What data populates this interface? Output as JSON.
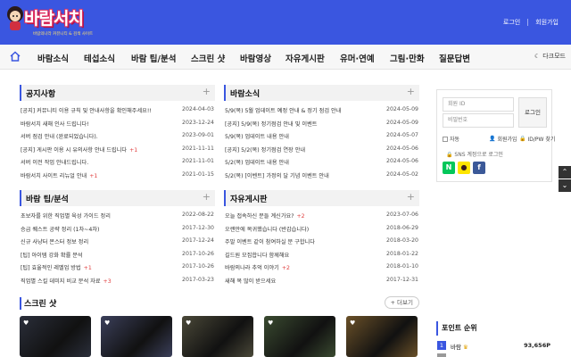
{
  "header": {
    "logo_text": "바람서치",
    "logo_sub": "바람의나라 커뮤니티 & 검색 사이트",
    "links": [
      "로그인",
      "회원가입"
    ]
  },
  "nav": {
    "items": [
      "바람소식",
      "테섭소식",
      "바람 팁/분석",
      "스크린 샷",
      "바람영상",
      "자유게시판",
      "유머·연예",
      "그림·만화",
      "질문답변"
    ],
    "dark_mode": "다크모드"
  },
  "panels": {
    "notice": {
      "title": "공지사항",
      "rows": [
        {
          "title": "[공지] 커뮤니티 이용 규칙 및 안내사항을 확인해주세요!!",
          "date": "2024-04-03",
          "count": ""
        },
        {
          "title": "바람서치 새해 인사 드립니다!",
          "date": "2023-12-24",
          "count": ""
        },
        {
          "title": "서버 점검 안내 (완료되었습니다).",
          "date": "2023-09-01",
          "count": ""
        },
        {
          "title": "[공지] 게시판 이용 시 유의사항 안내 드립니다",
          "date": "2021-11-11",
          "count": "+1"
        },
        {
          "title": "서버 이전 작업 안내드립니다.",
          "date": "2021-11-01",
          "count": ""
        },
        {
          "title": "바람서치 사이트 리뉴얼 안내",
          "date": "2021-01-15",
          "count": "+1"
        }
      ]
    },
    "news": {
      "title": "바람소식",
      "rows": [
        {
          "title": "5/9(목) 5월 업데이트 예정 안내 & 정기 점검 안내",
          "date": "2024-05-09",
          "count": ""
        },
        {
          "title": "[공지] 5/9(목) 정기점검 안내 및 이벤트",
          "date": "2024-05-09",
          "count": ""
        },
        {
          "title": "5/9(목) 업데이트 내용 안내",
          "date": "2024-05-07",
          "count": ""
        },
        {
          "title": "[공지] 5/2(목) 정기점검 연장 안내",
          "date": "2024-05-06",
          "count": ""
        },
        {
          "title": "5/2(목) 업데이트 내용 안내",
          "date": "2024-05-06",
          "count": ""
        },
        {
          "title": "5/2(목) [이벤트] 가정의 달 기념 이벤트 안내",
          "date": "2024-05-02",
          "count": ""
        }
      ]
    },
    "tips": {
      "title": "바람 팁/분석",
      "rows": [
        {
          "title": "초보자를 위한 직업별 육성 가이드 정리",
          "date": "2022-08-22",
          "count": ""
        },
        {
          "title": "승급 퀘스트 공략 정리 (1차~4차)",
          "date": "2017-12-30",
          "count": ""
        },
        {
          "title": "신규 사냥터 몬스터 정보 정리",
          "date": "2017-12-24",
          "count": ""
        },
        {
          "title": "[팁] 아이템 강화 확률 분석",
          "date": "2017-10-26",
          "count": ""
        },
        {
          "title": "[팁] 효율적인 레벨업 방법",
          "date": "2017-10-26",
          "count": "+1"
        },
        {
          "title": "직업별 스킬 데미지 비교 분석 자료",
          "date": "2017-03-23",
          "count": "+3"
        }
      ]
    },
    "free": {
      "title": "자유게시판",
      "rows": [
        {
          "title": "오늘 접속하신 분들 계신가요?",
          "date": "2023-07-06",
          "count": "+2"
        },
        {
          "title": "오랜만에 복귀했습니다 (반갑습니다)",
          "date": "2018-06-29",
          "count": ""
        },
        {
          "title": "주말 이벤트 같이 참여하실 분 구합니다",
          "date": "2018-03-20",
          "count": ""
        },
        {
          "title": "길드원 모집합니다 함께해요",
          "date": "2018-01-22",
          "count": ""
        },
        {
          "title": "바람의나라 추억 이야기",
          "date": "2018-01-10",
          "count": "+2"
        },
        {
          "title": "새해 복 많이 받으세요",
          "date": "2017-12-31",
          "count": ""
        }
      ]
    }
  },
  "screenshots": {
    "title": "스크린 샷",
    "more": "더보기",
    "colors": [
      "#2a2e3a",
      "#3b3f5a",
      "#4a4838",
      "#3a4a30",
      "#6a5028"
    ]
  },
  "login": {
    "id_placeholder": "회원 ID",
    "pw_placeholder": "비밀번호",
    "button": "로그인",
    "auto": "자동",
    "signup": "회원가입",
    "find": "ID/PW 찾기",
    "sns": "SNS 계정으로 로그인"
  },
  "ranking": {
    "title": "포인트 순위",
    "rows": [
      {
        "rank": "1",
        "name": "바람",
        "points": "93,656P"
      }
    ]
  }
}
